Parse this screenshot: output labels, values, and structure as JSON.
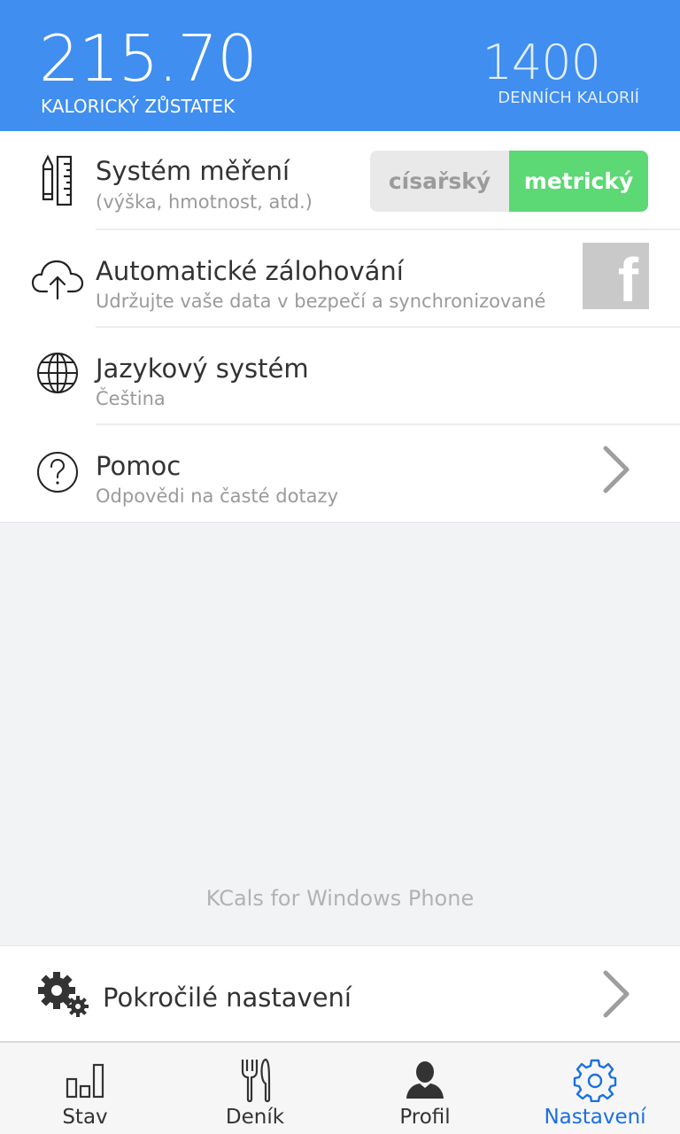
{
  "header": {
    "balance_value": "215.70",
    "balance_label": "KALORICKÝ ZŮSTATEK",
    "daily_value": "1400",
    "daily_label": "DENNÍCH KALORIÍ",
    "bg_color": "#3f8ef0"
  },
  "settings": {
    "units": {
      "title": "Systém měření",
      "subtitle": "(výška, hmotnost, atd.)",
      "icon": "ruler-pencil-icon",
      "options": [
        "císařský",
        "metrický"
      ],
      "selected": "metrický",
      "active_color": "#5cd874"
    },
    "backup": {
      "title": "Automatické zálohování",
      "subtitle": "Udržujte vaše data v bezpečí a synchronizované",
      "icon": "cloud-upload-icon",
      "service_icon": "facebook-icon",
      "service_letter": "f"
    },
    "language": {
      "title": "Jazykový systém",
      "subtitle": "Čeština",
      "icon": "globe-icon"
    },
    "help": {
      "title": "Pomoc",
      "subtitle": "Odpovědi na časté dotazy",
      "icon": "question-icon"
    }
  },
  "footer_text": "KCals for Windows Phone",
  "advanced": {
    "title": "Pokročilé nastavení",
    "icon": "gears-icon"
  },
  "tabs": [
    {
      "label": "Stav",
      "icon": "bar-chart-icon",
      "active": false
    },
    {
      "label": "Deník",
      "icon": "fork-knife-icon",
      "active": false
    },
    {
      "label": "Profil",
      "icon": "user-icon",
      "active": false
    },
    {
      "label": "Nastavení",
      "icon": "gear-icon",
      "active": true
    }
  ],
  "accent_color": "#1b6fe0"
}
